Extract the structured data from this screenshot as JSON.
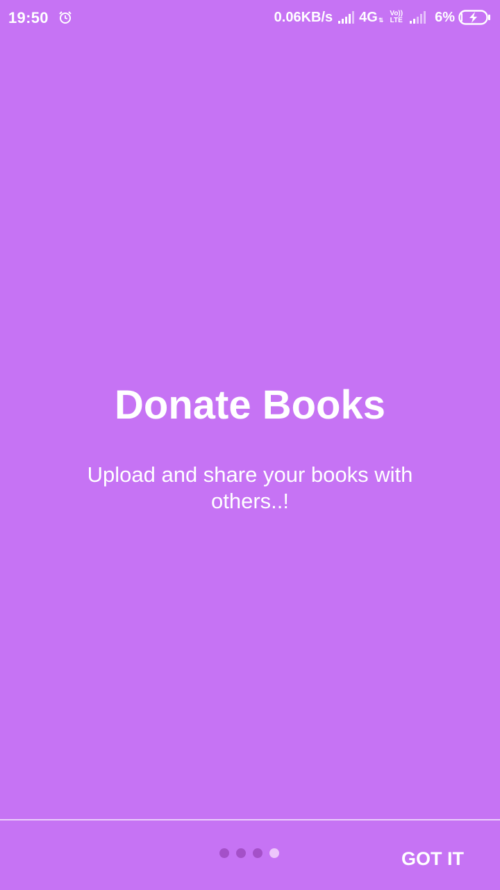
{
  "status_bar": {
    "time": "19:50",
    "net_speed": "0.06KB/s",
    "network_type": "4G",
    "network_arrows": "⇅",
    "volte_top": "Vo))",
    "volte_bottom": "LTE",
    "battery_percent": "6%",
    "icons": [
      "alarm-icon",
      "signal-icon",
      "signal-weak-icon",
      "battery-charging-icon"
    ]
  },
  "intro": {
    "title": "Donate Books",
    "description": "Upload and share your books with others..!"
  },
  "footer": {
    "page_count": 4,
    "active_page": 4,
    "got_it_label": "GOT IT"
  },
  "colors": {
    "background": "#c673f4",
    "dot_inactive": "#a450c8",
    "dot_active": "#edc6fb",
    "text": "#ffffff"
  }
}
